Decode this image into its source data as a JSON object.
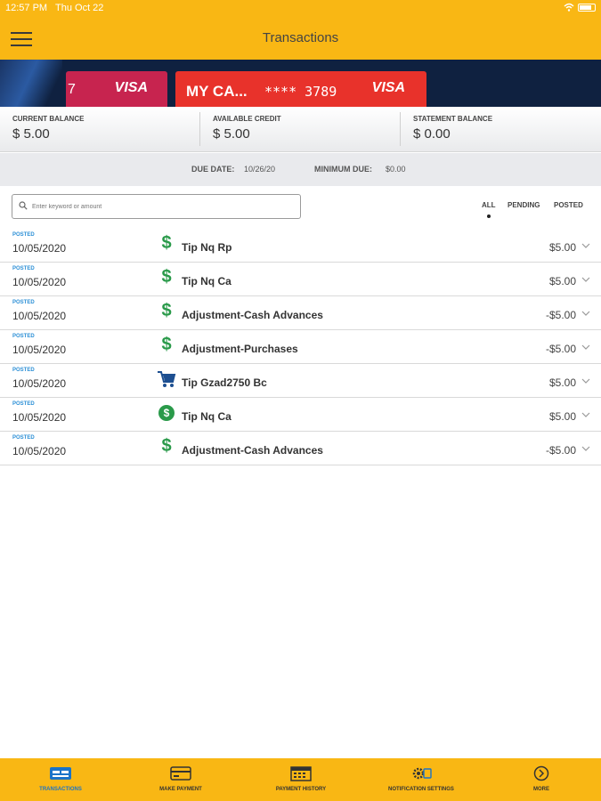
{
  "status": {
    "time": "12:57 PM",
    "date": "Thu Oct 22"
  },
  "header": {
    "title": "Transactions"
  },
  "cards": [
    {
      "number_fragment": "7",
      "network": "VISA"
    },
    {
      "name": "MY CA...",
      "masked": "**** 3789",
      "network": "VISA"
    }
  ],
  "balances": {
    "current": {
      "label": "CURRENT BALANCE",
      "value": "$ 5.00"
    },
    "available": {
      "label": "AVAILABLE CREDIT",
      "value": "$ 5.00"
    },
    "statement": {
      "label": "STATEMENT BALANCE",
      "value": "$ 0.00"
    }
  },
  "due": {
    "date_label": "DUE DATE:",
    "date_value": "10/26/20",
    "min_label": "MINIMUM DUE:",
    "min_value": "$0.00"
  },
  "search": {
    "placeholder": "Enter keyword or amount"
  },
  "filters": {
    "all": "ALL",
    "pending": "PENDING",
    "posted": "POSTED",
    "selected": "ALL"
  },
  "transactions": [
    {
      "status": "POSTED",
      "date": "10/05/2020",
      "description": "Tip Nq Rp",
      "amount": "$5.00",
      "icon": "dollar-icon"
    },
    {
      "status": "POSTED",
      "date": "10/05/2020",
      "description": "Tip Nq Ca",
      "amount": "$5.00",
      "icon": "dollar-icon"
    },
    {
      "status": "POSTED",
      "date": "10/05/2020",
      "description": "Adjustment-Cash Advances",
      "amount": "-$5.00",
      "icon": "dollar-icon"
    },
    {
      "status": "POSTED",
      "date": "10/05/2020",
      "description": "Adjustment-Purchases",
      "amount": "-$5.00",
      "icon": "dollar-icon"
    },
    {
      "status": "POSTED",
      "date": "10/05/2020",
      "description": "Tip Gzad2750 Bc",
      "amount": "$5.00",
      "icon": "shopping-cart-icon"
    },
    {
      "status": "POSTED",
      "date": "10/05/2020",
      "description": "Tip Nq Ca",
      "amount": "$5.00",
      "icon": "dollar-circle-icon"
    },
    {
      "status": "POSTED",
      "date": "10/05/2020",
      "description": "Adjustment-Cash Advances",
      "amount": "-$5.00",
      "icon": "dollar-icon"
    }
  ],
  "tabs": [
    {
      "label": "TRANSACTIONS",
      "icon": "transactions-icon",
      "active": true
    },
    {
      "label": "MAKE PAYMENT",
      "icon": "card-payment-icon",
      "active": false
    },
    {
      "label": "PAYMENT HISTORY",
      "icon": "calendar-icon",
      "active": false
    },
    {
      "label": "NOTIFICATION SETTINGS",
      "icon": "settings-gear-icon",
      "active": false
    },
    {
      "label": "MORE",
      "icon": "more-arrow-icon",
      "active": false
    }
  ],
  "colors": {
    "brand_yellow": "#f9b714",
    "green": "#2a9a4a",
    "blue": "#2b8fd6",
    "card_red": "#e8322b",
    "card_pink": "#c7244f"
  }
}
